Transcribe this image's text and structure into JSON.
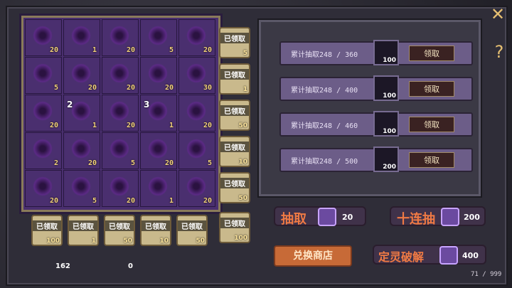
{
  "board": {
    "cells": [
      [
        "20",
        "1",
        "20",
        "5",
        "20"
      ],
      [
        "5",
        "20",
        "20",
        "20",
        "30"
      ],
      [
        "20",
        "1",
        "20",
        "1",
        "20"
      ],
      [
        "2",
        "20",
        "5",
        "20",
        "5"
      ],
      [
        "20",
        "5",
        "20",
        "1",
        "20"
      ]
    ],
    "badges": {
      "r2c1": "2",
      "r2c3": "3"
    }
  },
  "claimed_right_col": [
    {
      "label": "已领取",
      "num": "5"
    },
    {
      "label": "已领取",
      "num": "1"
    },
    {
      "label": "已领取",
      "num": "50"
    },
    {
      "label": "已领取",
      "num": "10"
    },
    {
      "label": "已领取",
      "num": "50"
    }
  ],
  "claimed_bottom_row": [
    {
      "label": "已领取",
      "num": "100"
    },
    {
      "label": "已领取",
      "num": "1"
    },
    {
      "label": "已领取",
      "num": "50"
    },
    {
      "label": "已领取",
      "num": "10"
    },
    {
      "label": "已领取",
      "num": "50"
    },
    {
      "label": "已领取",
      "num": "100"
    }
  ],
  "cumulative_rewards": [
    {
      "text": "累计抽取248 / 360",
      "reward": "100",
      "button": "领取"
    },
    {
      "text": "累计抽取248 / 400",
      "reward": "100",
      "button": "领取"
    },
    {
      "text": "累计抽取248 / 460",
      "reward": "100",
      "button": "领取"
    },
    {
      "text": "累计抽取248 / 500",
      "reward": "200",
      "button": "领取"
    }
  ],
  "actions": {
    "draw_one": {
      "label": "抽取",
      "cost": "20"
    },
    "draw_ten": {
      "label": "十连抽",
      "cost": "200"
    },
    "exchange_shop": "兑换商店",
    "decompose": {
      "label": "定灵破解",
      "cost": "400"
    }
  },
  "resources": {
    "currency_left": "162",
    "currency_right": "0",
    "counter": "71 / 999"
  },
  "icons": {
    "close": "close-icon",
    "help": "help-icon"
  },
  "colors": {
    "gold": "#e7c072",
    "board": "#4a2f6f",
    "row": "#6c5d88"
  }
}
